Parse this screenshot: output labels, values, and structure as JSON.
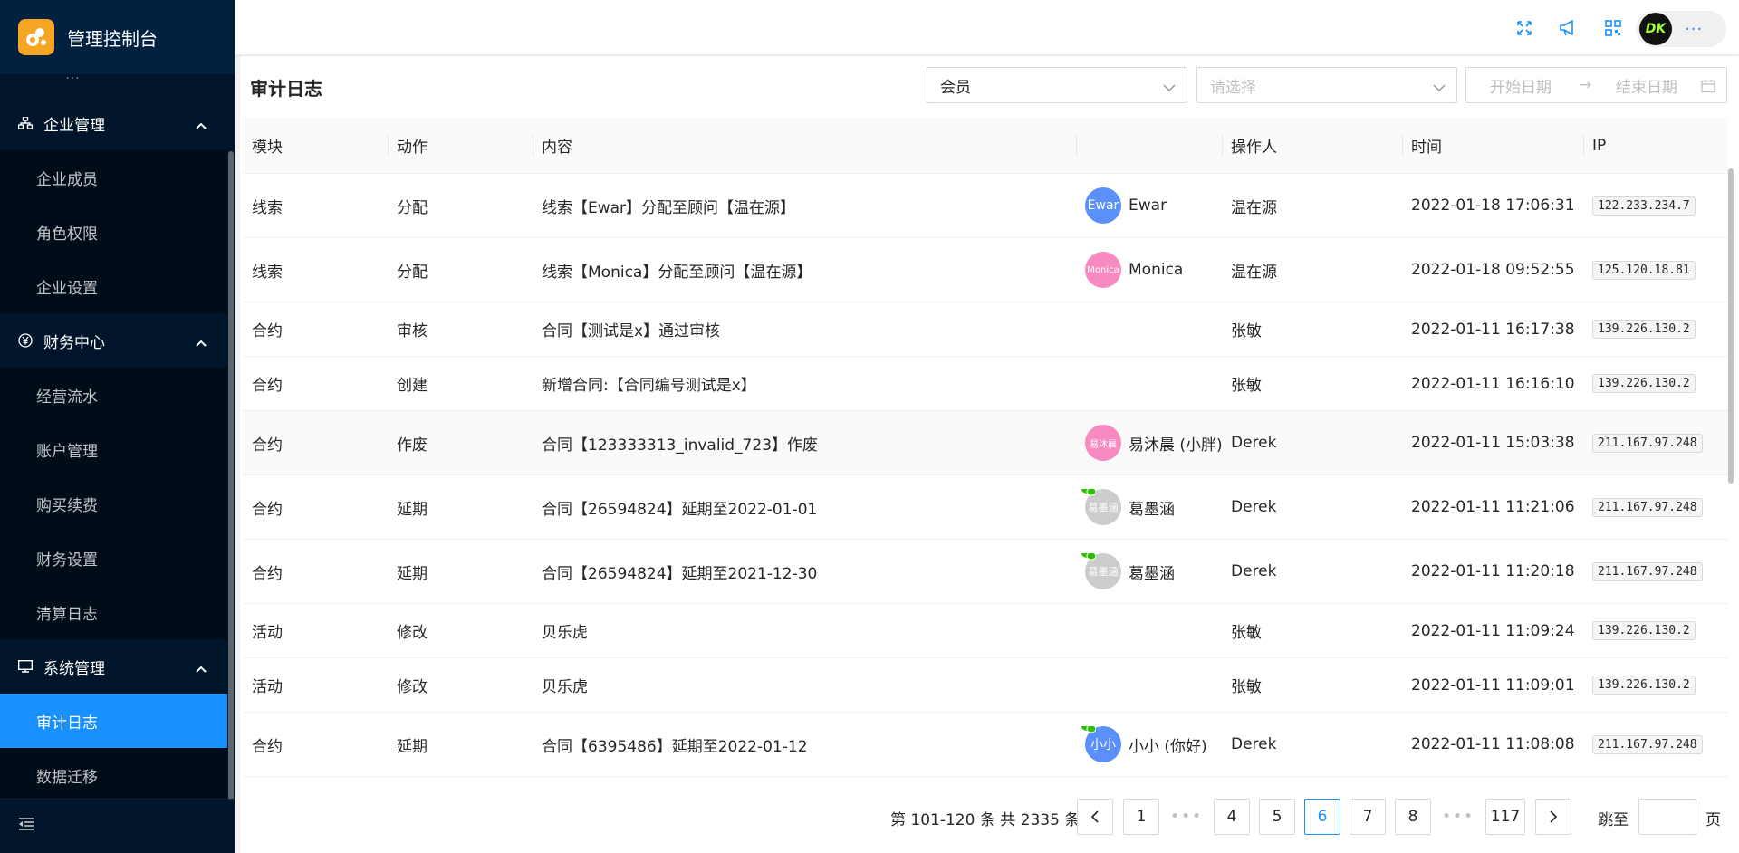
{
  "app": {
    "title": "管理控制台",
    "brand_color": "#1890ff",
    "sidebar_bg": "#001529"
  },
  "sidebar": {
    "stub_label": "…",
    "groups": [
      {
        "label": "企业管理",
        "icon": "org-icon",
        "items": [
          "企业成员",
          "角色权限",
          "企业设置"
        ]
      },
      {
        "label": "财务中心",
        "icon": "yen-icon",
        "items": [
          "经营流水",
          "账户管理",
          "购买续费",
          "财务设置",
          "清算日志"
        ]
      },
      {
        "label": "系统管理",
        "icon": "monitor-icon",
        "items": [
          "审计日志",
          "数据迁移"
        ]
      }
    ],
    "active_item": "审计日志"
  },
  "header": {
    "icons": [
      "fullscreen-icon",
      "notification-icon",
      "qrcode-icon"
    ],
    "user_avatar_text": "DK",
    "more": "···"
  },
  "page": {
    "title": "审计日志",
    "filters": {
      "type_value": "会员",
      "second_placeholder": "请选择",
      "start_placeholder": "开始日期",
      "end_placeholder": "结束日期",
      "range_sep": "→"
    }
  },
  "table": {
    "columns": [
      "模块",
      "动作",
      "内容",
      "",
      "操作人",
      "时间",
      "IP"
    ],
    "rows": [
      {
        "module": "线索",
        "action": "分配",
        "content": "线索【Ewar】分配至顾问【温在源】",
        "member_avatar": "Ewar",
        "member_name": "Ewar",
        "avatar_color": "blue",
        "wechat": false,
        "operator": "温在源",
        "time": "2022-01-18 17:06:31",
        "ip": "122.233.234.7"
      },
      {
        "module": "线索",
        "action": "分配",
        "content": "线索【Monica】分配至顾问【温在源】",
        "member_avatar": "Monica",
        "member_name": "Monica",
        "avatar_color": "pink",
        "wechat": false,
        "operator": "温在源",
        "time": "2022-01-18 09:52:55",
        "ip": "125.120.18.81"
      },
      {
        "module": "合约",
        "action": "审核",
        "content": "合同【测试是x】通过审核",
        "member_avatar": "",
        "member_name": "",
        "avatar_color": "",
        "wechat": false,
        "operator": "张敏",
        "time": "2022-01-11 16:17:38",
        "ip": "139.226.130.2"
      },
      {
        "module": "合约",
        "action": "创建",
        "content": "新增合同:【合同编号测试是x】",
        "member_avatar": "",
        "member_name": "",
        "avatar_color": "",
        "wechat": false,
        "operator": "张敏",
        "time": "2022-01-11 16:16:10",
        "ip": "139.226.130.2"
      },
      {
        "module": "合约",
        "action": "作废",
        "content": "合同【123333313_invalid_723】作废",
        "member_avatar": "易沐晨",
        "member_name": "易沐晨 (小胖)",
        "avatar_color": "pink",
        "wechat": false,
        "operator": "Derek",
        "time": "2022-01-11 15:03:38",
        "ip": "211.167.97.248"
      },
      {
        "module": "合约",
        "action": "延期",
        "content": "合同【26594824】延期至2022-01-01",
        "member_avatar": "葛墨涵",
        "member_name": "葛墨涵",
        "avatar_color": "grey",
        "wechat": true,
        "operator": "Derek",
        "time": "2022-01-11 11:21:06",
        "ip": "211.167.97.248"
      },
      {
        "module": "合约",
        "action": "延期",
        "content": "合同【26594824】延期至2021-12-30",
        "member_avatar": "葛墨涵",
        "member_name": "葛墨涵",
        "avatar_color": "grey",
        "wechat": true,
        "operator": "Derek",
        "time": "2022-01-11 11:20:18",
        "ip": "211.167.97.248"
      },
      {
        "module": "活动",
        "action": "修改",
        "content": "贝乐虎",
        "member_avatar": "",
        "member_name": "",
        "avatar_color": "",
        "wechat": false,
        "operator": "张敏",
        "time": "2022-01-11 11:09:24",
        "ip": "139.226.130.2"
      },
      {
        "module": "活动",
        "action": "修改",
        "content": "贝乐虎",
        "member_avatar": "",
        "member_name": "",
        "avatar_color": "",
        "wechat": false,
        "operator": "张敏",
        "time": "2022-01-11 11:09:01",
        "ip": "139.226.130.2"
      },
      {
        "module": "合约",
        "action": "延期",
        "content": "合同【6395486】延期至2022-01-12",
        "member_avatar": "小小",
        "member_name": "小小 (你好)",
        "avatar_color": "blue",
        "wechat": true,
        "operator": "Derek",
        "time": "2022-01-11 11:08:08",
        "ip": "211.167.97.248"
      }
    ]
  },
  "pagination": {
    "total_text": "第 101-120 条 共 2335 条",
    "pages": [
      "1",
      "•••",
      "4",
      "5",
      "6",
      "7",
      "8",
      "•••",
      "117"
    ],
    "current": "6",
    "jump_label": "跳至",
    "page_suffix": "页"
  }
}
